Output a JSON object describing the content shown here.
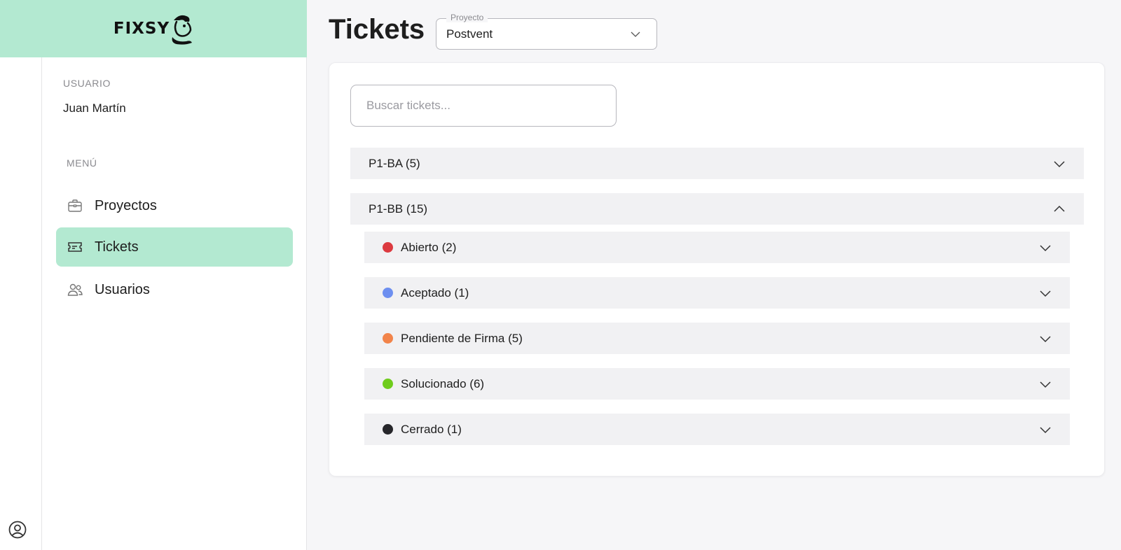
{
  "app": {
    "logo_text": "FIXSY"
  },
  "sidebar": {
    "user_section_label": "USUARIO",
    "user_name": "Juan Martín",
    "menu_section_label": "MENÚ",
    "items": [
      {
        "label": "Proyectos",
        "icon": "briefcase-icon",
        "active": false
      },
      {
        "label": "Tickets",
        "icon": "ticket-icon",
        "active": true
      },
      {
        "label": "Usuarios",
        "icon": "users-icon",
        "active": false
      }
    ],
    "account_icon": "account-circle-icon"
  },
  "header": {
    "title": "Tickets",
    "project_select": {
      "legend": "Proyecto",
      "value": "Postvent"
    }
  },
  "search": {
    "placeholder": "Buscar tickets..."
  },
  "groups": [
    {
      "label": "P1-BA (5)",
      "expanded": false
    },
    {
      "label": "P1-BB (15)",
      "expanded": true,
      "statuses": [
        {
          "label": "Abierto (2)",
          "color": "#dc3a40"
        },
        {
          "label": "Aceptado (1)",
          "color": "#6d8ff0"
        },
        {
          "label": "Pendiente de Firma (5)",
          "color": "#f2844a"
        },
        {
          "label": "Solucionado (6)",
          "color": "#6fcc1c"
        },
        {
          "label": "Cerrado (1)",
          "color": "#26262a"
        }
      ]
    }
  ],
  "colors": {
    "accent": "#b3e9d1",
    "background": "#f6f6f8",
    "row_bg": "#f1f1f3"
  }
}
